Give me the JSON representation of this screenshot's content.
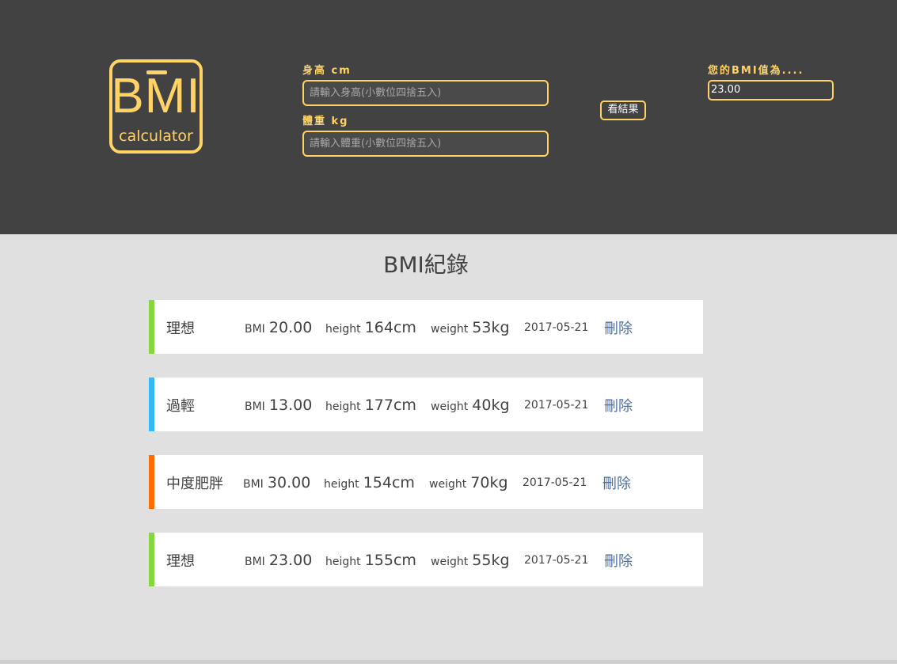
{
  "logo": {
    "main_text": "BMI",
    "sub_text": "calculator"
  },
  "form": {
    "height_label": "身高 cm",
    "height_placeholder": "請輸入身高(小數位四捨五入)",
    "weight_label": "體重 kg",
    "weight_placeholder": "請輸入體重(小數位四捨五入)",
    "submit_label": "看結果",
    "result_label": "您的BMI值為....",
    "result_value": "23.00"
  },
  "records_title": "BMI紀錄",
  "labels": {
    "bmi": "BMI",
    "height": "height",
    "weight": "weight",
    "delete": "刪除"
  },
  "colors": {
    "accent": "#ffd366",
    "header_bg": "#424242",
    "ideal": "#86d73f",
    "underweight": "#31baf9",
    "moderately_obese": "#ff6c02",
    "delete_link": "#4a6ea9"
  },
  "records": [
    {
      "status": "理想",
      "bmi": "20.00",
      "height": "164cm",
      "weight": "53kg",
      "date": "2017-05-21",
      "color": "#86d73f"
    },
    {
      "status": "過輕",
      "bmi": "13.00",
      "height": "177cm",
      "weight": "40kg",
      "date": "2017-05-21",
      "color": "#31baf9"
    },
    {
      "status": "中度肥胖",
      "bmi": "30.00",
      "height": "154cm",
      "weight": "70kg",
      "date": "2017-05-21",
      "color": "#ff6c02"
    },
    {
      "status": "理想",
      "bmi": "23.00",
      "height": "155cm",
      "weight": "55kg",
      "date": "2017-05-21",
      "color": "#86d73f"
    }
  ]
}
